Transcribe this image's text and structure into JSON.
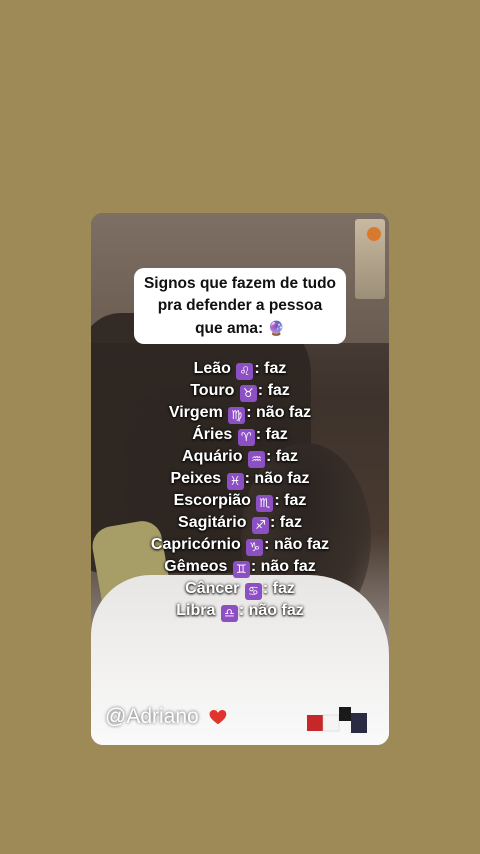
{
  "title": {
    "line1": "Signos que fazem de tudo",
    "line2": "pra defender a pessoa",
    "line3": "que ama:",
    "emoji": "🔮"
  },
  "signs": [
    {
      "name": "Leão",
      "symbol": "♌",
      "result": ": faz"
    },
    {
      "name": "Touro",
      "symbol": "♉",
      "result": ": faz"
    },
    {
      "name": "Virgem",
      "symbol": "♍",
      "result": ": não faz"
    },
    {
      "name": "Áries",
      "symbol": "♈",
      "result": ": faz"
    },
    {
      "name": "Aquário",
      "symbol": "♒",
      "result": ": faz"
    },
    {
      "name": "Peixes",
      "symbol": "♓",
      "result": ": não faz"
    },
    {
      "name": "Escorpião",
      "symbol": "♏",
      "result": ": faz"
    },
    {
      "name": "Sagitário",
      "symbol": "♐",
      "result": ": faz"
    },
    {
      "name": "Capricórnio",
      "symbol": "♑",
      "result": ": não faz"
    },
    {
      "name": "Gêmeos",
      "symbol": "♊",
      "result": ": não faz"
    },
    {
      "name": "Câncer",
      "symbol": "♋",
      "result": ": faz"
    },
    {
      "name": "Libra",
      "symbol": "♎",
      "result": ": não faz"
    }
  ],
  "watermark": "@Adriano",
  "colors": {
    "background": "#9e8a56",
    "zodiac_badge": "#8c4fc4",
    "heart": "#e0342f"
  },
  "icons": {
    "watermark_emoji": "heart-on-fire-icon"
  }
}
